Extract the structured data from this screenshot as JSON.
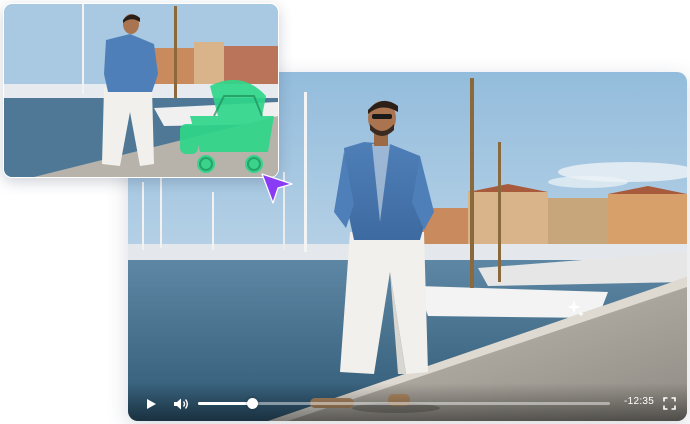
{
  "player": {
    "time_remaining": "-12:35",
    "progress": 0.13,
    "accent_color": "#ffffff"
  },
  "icons": {
    "play": "play-icon",
    "volume": "volume-icon",
    "fullscreen": "fullscreen-icon",
    "sparkle": "sparkle-icon",
    "pointer": "pointer-cursor-icon"
  },
  "thumbnail": {
    "highlight_color": "#2fd68a",
    "highlighted_object": "stroller"
  },
  "cursor_color": "#8a3cf5"
}
